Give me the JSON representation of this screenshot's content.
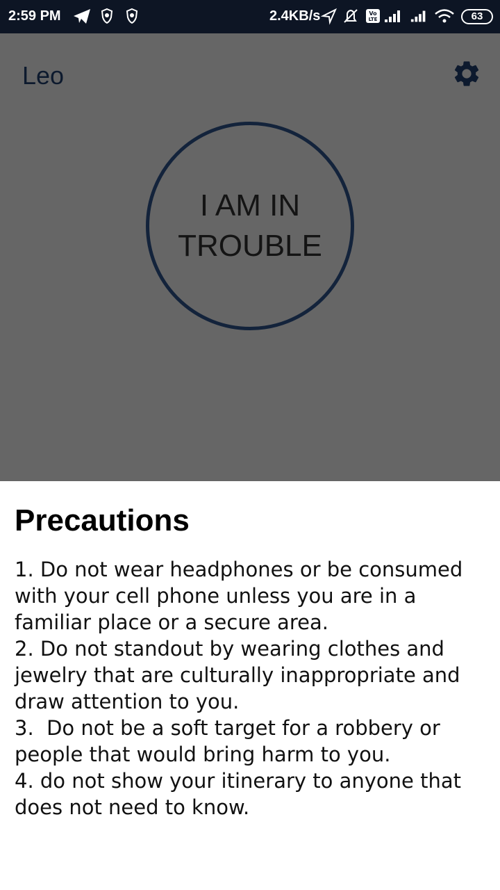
{
  "status_bar": {
    "time": "2:59 PM",
    "net_speed": "2.4KB/s",
    "battery": "63",
    "icons": [
      "telegram-icon",
      "vpn-shield-icon",
      "vpn-shield-icon",
      "location-icon",
      "alarm-off-icon",
      "volte-icon",
      "signal-icon",
      "signal-icon",
      "wifi-icon",
      "battery-icon"
    ]
  },
  "app": {
    "title": "Leo",
    "settings_icon": "gear-icon",
    "trouble_button_label": "I AM IN TROUBLE"
  },
  "precautions": {
    "title": "Precautions",
    "items": [
      "1. Do not wear headphones or be consumed with your cell phone unless you are in a familiar place or a secure area.",
      "2. Do not standout by wearing clothes and jewelry that are culturally inappropriate and draw attention to you.",
      "3.  Do not be a soft target for a robbery or people that would bring harm to you.",
      "4. do not show your itinerary to anyone that does not need to know."
    ]
  },
  "colors": {
    "status_bar": "#0d1524",
    "overlay": "#666666",
    "circle_border": "#13233b",
    "sheet": "#ffffff"
  }
}
